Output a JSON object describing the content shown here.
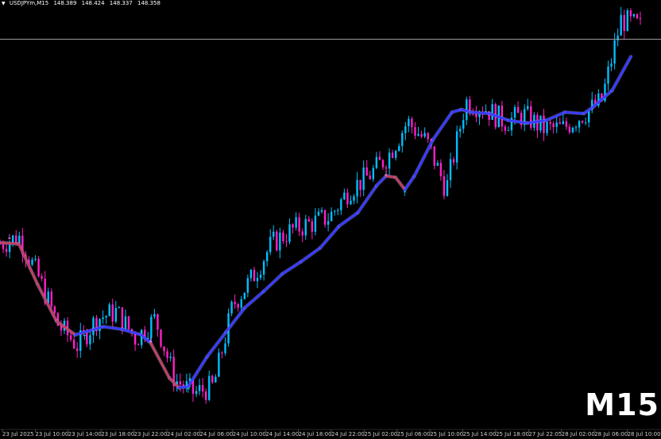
{
  "header": {
    "symbol": "USDJPYm,M15",
    "open": "148.389",
    "high": "148.424",
    "low": "148.337",
    "close": "148.358"
  },
  "timeframe_label": "M15",
  "colors": {
    "background": "#000000",
    "bull_candle": "#00bfff",
    "bear_candle": "#ff20c8",
    "ma_up": "#3b3bff",
    "ma_down": "#c04060",
    "price_line": "#a0a0a0",
    "arrow_up": "#00c8ff",
    "arrow_down": "#ff80ff"
  },
  "chart_data": {
    "type": "line",
    "symbol": "USDJPYm",
    "timeframe": "M15",
    "x_tick_labels": [
      "23 Jul 2025",
      "23 Jul 10:00",
      "23 Jul 14:00",
      "23 Jul 18:00",
      "23 Jul 22:00",
      "24 Jul 02:00",
      "24 Jul 06:00",
      "24 Jul 10:00",
      "24 Jul 14:00",
      "24 Jul 18:00",
      "24 Jul 22:00",
      "25 Jul 02:00",
      "25 Jul 06:00",
      "25 Jul 10:00",
      "25 Jul 14:00",
      "25 Jul 18:00",
      "27 Jul 22:05",
      "28 Jul 02:00",
      "28 Jul 06:00",
      "28 Jul 10:00"
    ],
    "ylim": [
      145.5,
      148.6
    ],
    "current_price": 148.358,
    "price_path": [
      146.85,
      146.9,
      146.6,
      146.25,
      146.1,
      146.3,
      146.35,
      146.15,
      146.3,
      145.85,
      145.75,
      145.8,
      146.4,
      146.6,
      146.85,
      146.95,
      147.0,
      147.05,
      147.25,
      147.35,
      147.5,
      147.75,
      147.6,
      147.25,
      147.9,
      147.85,
      147.75,
      147.8,
      147.7,
      147.7,
      147.8,
      147.9,
      148.5,
      148.45
    ],
    "ma_series": {
      "name": "MA",
      "points": [
        [
          0,
          146.86
        ],
        [
          2,
          146.85
        ],
        [
          4,
          146.55
        ],
        [
          6,
          146.28
        ],
        [
          8,
          146.18
        ],
        [
          10,
          146.22
        ],
        [
          11,
          146.24
        ],
        [
          13,
          146.22
        ],
        [
          15,
          146.18
        ],
        [
          16,
          146.12
        ],
        [
          18,
          145.86
        ],
        [
          19,
          145.79
        ],
        [
          20,
          145.8
        ],
        [
          22,
          146.02
        ],
        [
          24,
          146.2
        ],
        [
          26,
          146.38
        ],
        [
          28,
          146.5
        ],
        [
          30,
          146.63
        ],
        [
          32,
          146.72
        ],
        [
          34,
          146.82
        ],
        [
          36,
          146.98
        ],
        [
          38,
          147.08
        ],
        [
          40,
          147.28
        ],
        [
          41,
          147.35
        ],
        [
          42,
          147.34
        ],
        [
          43,
          147.25
        ],
        [
          44,
          147.35
        ],
        [
          46,
          147.62
        ],
        [
          48,
          147.82
        ],
        [
          49,
          147.84
        ],
        [
          50,
          147.82
        ],
        [
          52,
          147.81
        ],
        [
          54,
          147.76
        ],
        [
          56,
          147.74
        ],
        [
          58,
          147.76
        ],
        [
          60,
          147.82
        ],
        [
          62,
          147.81
        ],
        [
          63,
          147.86
        ],
        [
          65,
          147.98
        ],
        [
          67,
          148.23
        ]
      ],
      "down_segments": [
        [
          0,
          8
        ],
        [
          16,
          19
        ],
        [
          41,
          43
        ]
      ]
    },
    "signals": [
      {
        "type": "down",
        "x": 1,
        "price": 146.9
      },
      {
        "type": "up",
        "x": 9,
        "price": 146.16
      },
      {
        "type": "down",
        "x": 16,
        "price": 146.14
      },
      {
        "type": "up",
        "x": 20,
        "price": 145.77
      },
      {
        "type": "down",
        "x": 41,
        "price": 147.37
      },
      {
        "type": "up",
        "x": 43,
        "price": 147.22
      }
    ]
  }
}
